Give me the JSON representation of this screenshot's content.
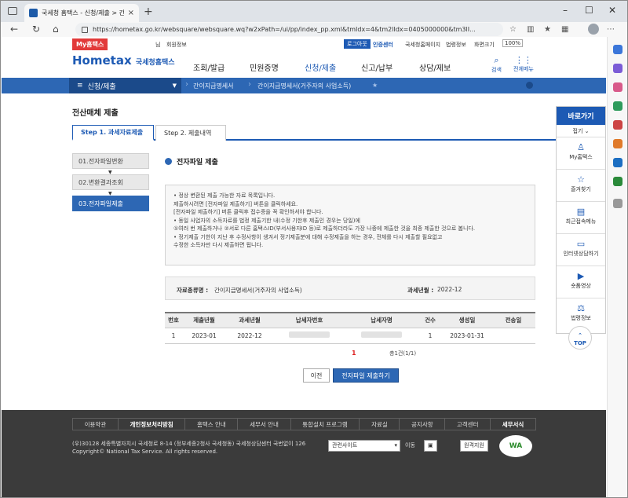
{
  "browser": {
    "tab_title": "국세청 홈택스 - 신청/제출 > 간이",
    "url": "https://hometax.go.kr/websquare/websquare.wq?w2xPath=/ui/pp/index_pp.xml&tmIdx=4&tm2lIdx=0405000000&tm3lI..."
  },
  "util": {
    "badge": "My홈택스",
    "user": "님",
    "member_info": "회원정보",
    "logout": "로그아웃",
    "cert_center": "인증센터",
    "nts_page": "국세청홈페이지",
    "law_info": "법령정보",
    "zoom_label": "화면크기",
    "zoom_value": "100%"
  },
  "gnb": {
    "logo": "Hometax",
    "logo_sub": "국세청홈택스",
    "menus": [
      "조회/발급",
      "민원증명",
      "신청/제출",
      "신고/납부",
      "상담/제보"
    ],
    "search": "검색",
    "all_menu": "전체메뉴"
  },
  "breadcrumb": {
    "lead": "신청/제출",
    "seg1": "간이지급명세서",
    "seg2": "간이지급명세서(거주자의 사업소득)"
  },
  "main": {
    "title": "전산매체 제출",
    "tab1": "Step 1. 과세자료제출",
    "tab2": "Step 2. 제출내역",
    "left": [
      "01.전자파일변환",
      "02.변환결과조회",
      "03.전자파일제출"
    ],
    "section_title": "전자파일 제출",
    "notice": [
      "• 정상 변환된 제출 가능한 자료 목록입니다.",
      "   제출하시려면 [전자파일 제출하기] 버튼을 클릭하세요.",
      "   [전자파일 제출하기] 버튼 클릭후 접수증을 꼭 확인하셔야 합니다.",
      "• 동일 사업자의 소득자료를 법정 제출기한 내(수정 기한후 제출인 경우는 당일)에",
      "   ①여러 번 제출하거나 ②서로 다른 홈택스ID(부서사용자ID 등)로 제출하더라도 가장 나중에 제출한 것을 최종 제출한 것으로 봅니다.",
      "• 정기제출 기한이 지난 후 수정사항이 생겨서 정기제출분에 대해 수정제출을 하는 경우, 전체를 다시 제출할 필요없고",
      "   수정한 소득자만 다시 제출하면 됩니다."
    ],
    "info_type_label": "자료종류명 :",
    "info_type_value": "간이지급명세서(거주자의 사업소득)",
    "info_period_label": "과세년월 :",
    "info_period_value": "2022-12",
    "table": {
      "headers": [
        "번호",
        "제출년월",
        "과세년월",
        "납세자번호",
        "납세자명",
        "건수",
        "생성일",
        "전송일"
      ],
      "rows": [
        [
          "1",
          "2023-01",
          "2022-12",
          "",
          "",
          "1",
          "2023-01-31",
          ""
        ]
      ]
    },
    "page": "1",
    "count": "총1건(1/1)",
    "prev_btn": "이전",
    "submit_btn": "전자파일 제출하기"
  },
  "quick": {
    "title": "바로가기",
    "fold": "접기",
    "items": [
      "My홈택스",
      "즐겨찾기",
      "최근접속메뉴",
      "인터넷상담하기",
      "숏폼영상",
      "법령정보"
    ],
    "top": "TOP"
  },
  "footer": {
    "links": [
      "이용약관",
      "개인정보처리방침",
      "홈택스 안내",
      "세무서 안내",
      "통합설치 프로그램",
      "자료실",
      "공지사항",
      "고객센터",
      "세무서식"
    ],
    "address": "(우)30128 세종특별자치시 국세청로 8-14 (정부세종2청사 국세청동) 국세청상담센터 국번없이 126",
    "copyright": "Copyright© National Tax Service. All rights reserved.",
    "related_sites": "관련사이트",
    "go": "이동",
    "remote": "원격지원",
    "wa": "WA"
  }
}
